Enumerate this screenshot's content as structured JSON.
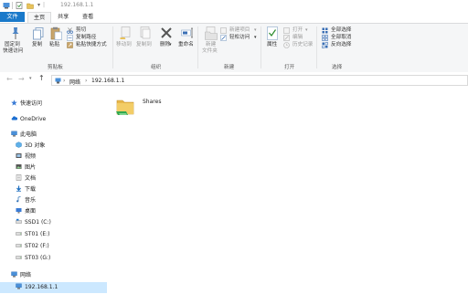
{
  "window": {
    "title_path": "192.168.1.1"
  },
  "ribbon_tabs": [
    "文件",
    "主页",
    "共享",
    "查看"
  ],
  "ribbon": {
    "clipboard": {
      "pin_label_1": "固定到",
      "pin_label_2": "快速访问",
      "copy": "复制",
      "paste": "粘贴",
      "cut": "剪切",
      "copy_path": "复制路径",
      "paste_shortcut": "粘贴快捷方式",
      "group": "剪贴板"
    },
    "organize": {
      "move_to": "移动到",
      "copy_to": "复制到",
      "delete": "删除",
      "rename": "重命名",
      "group": "组织"
    },
    "new": {
      "new_folder_1": "新建",
      "new_folder_2": "文件夹",
      "new_item": "新建项目",
      "easy_access": "轻松访问",
      "group": "新建"
    },
    "open": {
      "properties": "属性",
      "open": "打开",
      "edit": "编辑",
      "history": "历史记录",
      "group": "打开"
    },
    "select": {
      "select_all": "全部选择",
      "select_none": "全部取消",
      "invert": "反向选择",
      "group": "选择"
    }
  },
  "address": {
    "segments": [
      "网络",
      "192.168.1.1"
    ],
    "separator": "›"
  },
  "nav_pane": {
    "items": [
      {
        "label": "快速访问",
        "icon": "star-icon"
      },
      {
        "label": "OneDrive",
        "icon": "cloud-icon"
      },
      {
        "label": "此电脑",
        "icon": "computer-icon"
      },
      {
        "label": "3D 对象",
        "icon": "cube-icon"
      },
      {
        "label": "视频",
        "icon": "video-icon"
      },
      {
        "label": "图片",
        "icon": "picture-icon"
      },
      {
        "label": "文档",
        "icon": "document-icon"
      },
      {
        "label": "下载",
        "icon": "download-icon"
      },
      {
        "label": "音乐",
        "icon": "music-icon"
      },
      {
        "label": "桌面",
        "icon": "desktop-icon"
      },
      {
        "label": "SSD1 (C:)",
        "icon": "drive-icon"
      },
      {
        "label": "ST01 (E:)",
        "icon": "drive-icon"
      },
      {
        "label": "ST02 (F:)",
        "icon": "drive-icon"
      },
      {
        "label": "ST03 (G:)",
        "icon": "drive-icon"
      },
      {
        "label": "网络",
        "icon": "network-icon"
      },
      {
        "label": "192.168.1.1",
        "icon": "network-computer-icon"
      }
    ]
  },
  "content": {
    "items": [
      {
        "label": "Shares",
        "icon": "shared-folder-icon"
      }
    ]
  },
  "colors": {
    "accent": "#1979ca",
    "selection": "#cce8ff"
  }
}
